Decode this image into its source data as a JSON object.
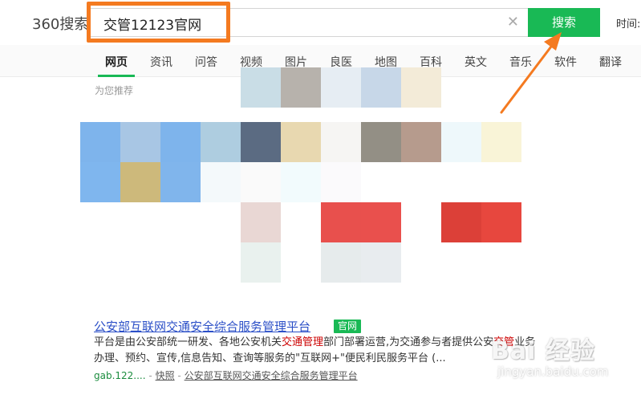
{
  "header": {
    "logo_text": "360搜索",
    "search_value": "交管12123官网",
    "search_button_label": "搜索",
    "clear_icon": "close-icon",
    "time_label": "时间:"
  },
  "nav": {
    "tabs": [
      {
        "label": "网页",
        "active": true
      },
      {
        "label": "资讯",
        "active": false
      },
      {
        "label": "问答",
        "active": false
      },
      {
        "label": "视频",
        "active": false
      },
      {
        "label": "图片",
        "active": false
      },
      {
        "label": "良医",
        "active": false
      },
      {
        "label": "地图",
        "active": false
      },
      {
        "label": "百科",
        "active": false
      },
      {
        "label": "英文",
        "active": false
      },
      {
        "label": "音乐",
        "active": false
      },
      {
        "label": "软件",
        "active": false
      },
      {
        "label": "翻译",
        "active": false
      }
    ]
  },
  "recommend": {
    "label": "为您推荐"
  },
  "result": {
    "title": "公安部互联网交通安全综合服务管理平台",
    "badge": "官网",
    "snippet_part1": "平台是由公安部统一研发、各地公安机关",
    "snippet_hl1": "交通管理",
    "snippet_part2": "部门部署运营,为交通参与者提供公安",
    "snippet_hl2": "交管",
    "snippet_part3": "业务办理、预约、宣传,信息告知、查询等服务的\"互联网+\"便民利民服务平台 (...",
    "url": "gab.122....",
    "separator": "-",
    "snapshot_label": "快照",
    "breadcrumb": "公安部互联网交通安全综合服务管理平台"
  },
  "watermark": {
    "main": "Bai 经验",
    "sub": "jingyan.baidu.com"
  },
  "colors": {
    "accent_green": "#19b955",
    "annotation_orange": "#f47a20",
    "link_blue": "#2b4fc7",
    "highlight_red": "#c00"
  }
}
